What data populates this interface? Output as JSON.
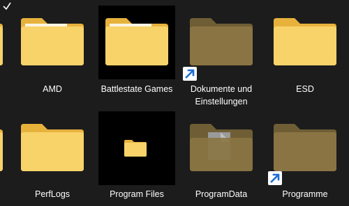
{
  "explorer": {
    "items": [
      {
        "name": "AMD",
        "type": "folder",
        "hidden": false,
        "shortcut": false,
        "selected": false
      },
      {
        "name": "Battlestate Games",
        "type": "folder",
        "hidden": false,
        "shortcut": false,
        "selected": true
      },
      {
        "name": "Dokumente und Einstellungen",
        "type": "folder",
        "hidden": true,
        "shortcut": true,
        "selected": false
      },
      {
        "name": "ESD",
        "type": "folder",
        "hidden": false,
        "shortcut": false,
        "selected": false
      },
      {
        "name": "PerfLogs",
        "type": "folder",
        "hidden": false,
        "shortcut": false,
        "selected": false
      },
      {
        "name": "Program Files",
        "type": "folder",
        "hidden": false,
        "shortcut": false,
        "selected": true
      },
      {
        "name": "ProgramData",
        "type": "folder",
        "hidden": true,
        "shortcut": false,
        "selected": false
      },
      {
        "name": "Programme",
        "type": "folder",
        "hidden": true,
        "shortcut": true,
        "selected": false
      }
    ]
  },
  "colors": {
    "background": "#1c1c1c",
    "selection": "#000000",
    "folder_front": "#f8d36a",
    "folder_back": "#e7b23c",
    "hidden_front": "#8a7443",
    "hidden_back": "#6f5e35",
    "shortcut_arrow": "#1f6fd1"
  },
  "icons": {
    "folder": "folder-icon",
    "shortcut_overlay": "shortcut-arrow-icon",
    "document": "document-icon"
  }
}
